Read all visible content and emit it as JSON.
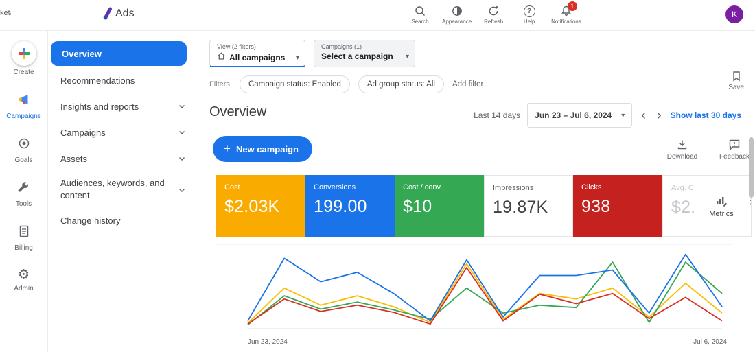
{
  "topbar": {
    "clipped_text": "keta",
    "brand": "Ads",
    "icons": [
      {
        "label": "Search"
      },
      {
        "label": "Appearance"
      },
      {
        "label": "Refresh"
      },
      {
        "label": "Help"
      },
      {
        "label": "Notifications",
        "badge": "1"
      }
    ],
    "avatar_letter": "K"
  },
  "rail": {
    "items": [
      {
        "label": "Create"
      },
      {
        "label": "Campaigns"
      },
      {
        "label": "Goals"
      },
      {
        "label": "Tools"
      },
      {
        "label": "Billing"
      },
      {
        "label": "Admin"
      }
    ]
  },
  "sidebar": {
    "items": [
      {
        "label": "Overview"
      },
      {
        "label": "Recommendations"
      },
      {
        "label": "Insights and reports"
      },
      {
        "label": "Campaigns"
      },
      {
        "label": "Assets"
      },
      {
        "label": "Audiences, keywords, and content"
      },
      {
        "label": "Change history"
      }
    ]
  },
  "filterbar": {
    "view_dropdown": {
      "caption": "View (2 filters)",
      "value": "All campaigns"
    },
    "campaign_dropdown": {
      "caption": "Campaigns (1)",
      "value": "Select a campaign"
    },
    "filters_label": "Filters",
    "chips": [
      {
        "label": "Campaign status: Enabled"
      },
      {
        "label": "Ad group status: All"
      }
    ],
    "add_filter": "Add filter",
    "save_label": "Save"
  },
  "header": {
    "title": "Overview",
    "range_caption": "Last 14 days",
    "date_range": "Jun 23 – Jul 6, 2024",
    "show_last_link": "Show last 30 days"
  },
  "toolbar": {
    "new_campaign_label": "New campaign",
    "download_label": "Download",
    "feedback_label": "Feedback"
  },
  "scorecards": [
    {
      "label": "Cost",
      "value": "$2.03K",
      "bg": "#F9AB00",
      "label_color": "#FFFFFF",
      "value_color": "#FFFFFF"
    },
    {
      "label": "Conversions",
      "value": "199.00",
      "bg": "#1A73E8",
      "label_color": "#FFFFFF",
      "value_color": "#FFFFFF"
    },
    {
      "label": "Cost / conv.",
      "value": "$10",
      "bg": "#34A853",
      "label_color": "#FFFFFF",
      "value_color": "#FFFFFF"
    },
    {
      "label": "Impressions",
      "value": "19.87K",
      "bg": "#FFFFFF",
      "label_color": "#5F6368",
      "value_color": "#3C4043"
    },
    {
      "label": "Clicks",
      "value": "938",
      "bg": "#C5221F",
      "label_color": "#FFFFFF",
      "value_color": "#FFFFFF"
    },
    {
      "label": "Avg. C",
      "value": "$2.",
      "bg": "#FFFFFF",
      "label_color": "#C4C7CC",
      "value_color": "#C4C7CC"
    }
  ],
  "metrics_control": {
    "label": "Metrics"
  },
  "chart_data": {
    "type": "line",
    "x_axis": {
      "start_label": "Jun 23, 2024",
      "end_label": "Jul 6, 2024",
      "points": 14
    },
    "ylim": [
      0,
      100
    ],
    "grid": false,
    "legend": "none",
    "series": [
      {
        "name": "Cost",
        "color": "#FBBC04",
        "values": [
          7,
          52,
          30,
          42,
          28,
          8,
          83,
          12,
          45,
          38,
          52,
          15,
          58,
          20
        ]
      },
      {
        "name": "Cost / conv.",
        "color": "#34A853",
        "values": [
          5,
          42,
          25,
          34,
          24,
          12,
          52,
          20,
          30,
          27,
          85,
          8,
          85,
          45
        ]
      },
      {
        "name": "Clicks",
        "color": "#D93025",
        "values": [
          6,
          38,
          22,
          30,
          21,
          6,
          78,
          10,
          44,
          32,
          45,
          13,
          40,
          10
        ]
      },
      {
        "name": "Conversions",
        "color": "#1A73E8",
        "values": [
          10,
          90,
          60,
          72,
          45,
          10,
          88,
          15,
          68,
          68,
          75,
          20,
          95,
          28
        ]
      }
    ]
  },
  "icons_glyphs": {
    "dropdown_arrow": "▾",
    "overflow_dots": "⋮",
    "chevron_left": "‹",
    "chevron_right": "›",
    "gear": "⚙",
    "plus": "+",
    "question": "?"
  }
}
